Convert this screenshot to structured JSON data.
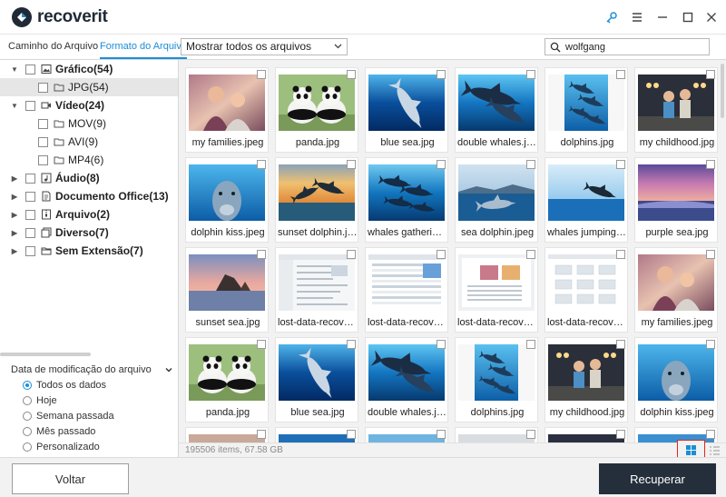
{
  "app": {
    "name": "recoverit"
  },
  "toolbar": {
    "tabs": [
      {
        "label": "Caminho do Arquivo"
      },
      {
        "label": "Formato do Arquivo"
      }
    ],
    "filter_value": "Mostrar todos os arquivos",
    "search_value": "wolfgang"
  },
  "tree": [
    {
      "label": "Gráfico(54)"
    },
    {
      "label": "JPG(54)"
    },
    {
      "label": "Vídeo(24)"
    },
    {
      "label": "MOV(9)"
    },
    {
      "label": "AVI(9)"
    },
    {
      "label": "MP4(6)"
    },
    {
      "label": "Áudio(8)"
    },
    {
      "label": "Documento Office(13)"
    },
    {
      "label": "Arquivo(2)"
    },
    {
      "label": "Diverso(7)"
    },
    {
      "label": "Sem Extensão(7)"
    }
  ],
  "date_filter": {
    "title": "Data de modificação do arquivo",
    "options": [
      "Todos os dados",
      "Hoje",
      "Semana passada",
      "Mês passado",
      "Personalizado"
    ]
  },
  "files": [
    {
      "name": "my families.jpeg"
    },
    {
      "name": "panda.jpg"
    },
    {
      "name": "blue sea.jpg"
    },
    {
      "name": "double whales.jpg"
    },
    {
      "name": "dolphins.jpg"
    },
    {
      "name": "my childhood.jpg"
    },
    {
      "name": "dolphin kiss.jpeg"
    },
    {
      "name": "sunset dolphin.jpg"
    },
    {
      "name": "whales gathering.jpg"
    },
    {
      "name": "sea dolphin.jpeg"
    },
    {
      "name": "whales jumping.jpg"
    },
    {
      "name": "purple sea.jpg"
    },
    {
      "name": "sunset sea.jpg"
    },
    {
      "name": "lost-data-recovery.jpg"
    },
    {
      "name": "lost-data-recovery.jpg"
    },
    {
      "name": "lost-data-recovery.jpg"
    },
    {
      "name": "lost-data-recovery.jpg"
    },
    {
      "name": "my families.jpeg"
    },
    {
      "name": "panda.jpg"
    },
    {
      "name": "blue sea.jpg"
    },
    {
      "name": "double whales.jpg"
    },
    {
      "name": "dolphins.jpg"
    },
    {
      "name": "my childhood.jpg"
    },
    {
      "name": "dolphin kiss.jpeg"
    }
  ],
  "status": {
    "text": "195506 items, 67.58 GB"
  },
  "footer": {
    "back_label": "Voltar",
    "recover_label": "Recuperar"
  },
  "colors": {
    "accent": "#1a8fd6",
    "dark_button": "#252f3b",
    "highlight_red": "#e1271b"
  }
}
